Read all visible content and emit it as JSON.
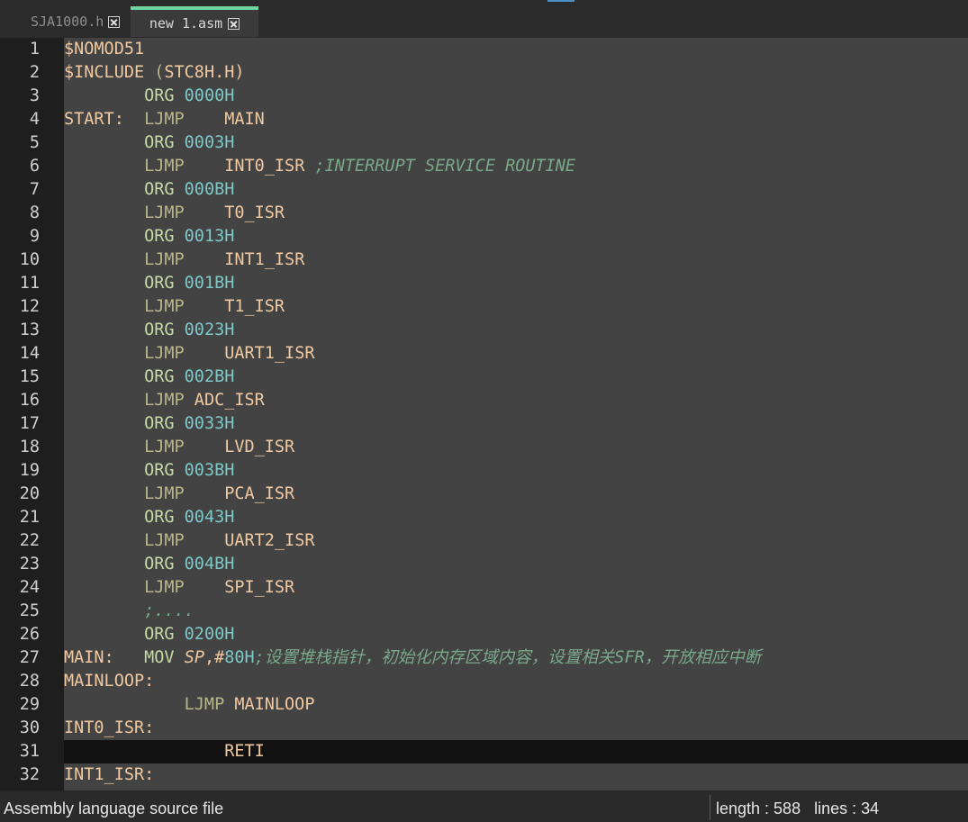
{
  "tabs": [
    {
      "label": "SJA1000.h",
      "active": false
    },
    {
      "label": "new 1.asm",
      "active": true
    }
  ],
  "editor": {
    "current_line": 31,
    "lines": [
      {
        "n": "1",
        "segs": [
          [
            "directive",
            "$NOMOD51"
          ]
        ]
      },
      {
        "n": "2",
        "segs": [
          [
            "directive",
            "$INCLUDE "
          ],
          [
            "paren",
            "("
          ],
          [
            "directive",
            "STC8H.H)"
          ]
        ]
      },
      {
        "n": "3",
        "segs": [
          [
            "op",
            "        "
          ],
          [
            "kw",
            "ORG"
          ],
          [
            "op",
            " "
          ],
          [
            "num",
            "0000H"
          ]
        ]
      },
      {
        "n": "4",
        "segs": [
          [
            "label",
            "START:"
          ],
          [
            "op",
            "  "
          ],
          [
            "jmp",
            "LJMP"
          ],
          [
            "op",
            "    MAIN"
          ]
        ]
      },
      {
        "n": "5",
        "segs": [
          [
            "op",
            "        "
          ],
          [
            "kw",
            "ORG"
          ],
          [
            "op",
            " "
          ],
          [
            "num",
            "0003H"
          ]
        ]
      },
      {
        "n": "6",
        "segs": [
          [
            "op",
            "        "
          ],
          [
            "jmp",
            "LJMP"
          ],
          [
            "op",
            "    INT0_ISR "
          ],
          [
            "comment",
            ";INTERRUPT SERVICE ROUTINE"
          ]
        ]
      },
      {
        "n": "7",
        "segs": [
          [
            "op",
            "        "
          ],
          [
            "kw",
            "ORG"
          ],
          [
            "op",
            " "
          ],
          [
            "num",
            "000BH"
          ]
        ]
      },
      {
        "n": "8",
        "segs": [
          [
            "op",
            "        "
          ],
          [
            "jmp",
            "LJMP"
          ],
          [
            "op",
            "    T0_ISR"
          ]
        ]
      },
      {
        "n": "9",
        "segs": [
          [
            "op",
            "        "
          ],
          [
            "kw",
            "ORG"
          ],
          [
            "op",
            " "
          ],
          [
            "num",
            "0013H"
          ]
        ]
      },
      {
        "n": "10",
        "segs": [
          [
            "op",
            "        "
          ],
          [
            "jmp",
            "LJMP"
          ],
          [
            "op",
            "    INT1_ISR"
          ]
        ]
      },
      {
        "n": "11",
        "segs": [
          [
            "op",
            "        "
          ],
          [
            "kw",
            "ORG"
          ],
          [
            "op",
            " "
          ],
          [
            "num",
            "001BH"
          ]
        ]
      },
      {
        "n": "12",
        "segs": [
          [
            "op",
            "        "
          ],
          [
            "jmp",
            "LJMP"
          ],
          [
            "op",
            "    T1_ISR"
          ]
        ]
      },
      {
        "n": "13",
        "segs": [
          [
            "op",
            "        "
          ],
          [
            "kw",
            "ORG"
          ],
          [
            "op",
            " "
          ],
          [
            "num",
            "0023H"
          ]
        ]
      },
      {
        "n": "14",
        "segs": [
          [
            "op",
            "        "
          ],
          [
            "jmp",
            "LJMP"
          ],
          [
            "op",
            "    UART1_ISR"
          ]
        ]
      },
      {
        "n": "15",
        "segs": [
          [
            "op",
            "        "
          ],
          [
            "kw",
            "ORG"
          ],
          [
            "op",
            " "
          ],
          [
            "num",
            "002BH"
          ]
        ]
      },
      {
        "n": "16",
        "segs": [
          [
            "op",
            "        "
          ],
          [
            "jmp",
            "LJMP"
          ],
          [
            "op",
            " ADC_ISR"
          ]
        ]
      },
      {
        "n": "17",
        "segs": [
          [
            "op",
            "        "
          ],
          [
            "kw",
            "ORG"
          ],
          [
            "op",
            " "
          ],
          [
            "num",
            "0033H"
          ]
        ]
      },
      {
        "n": "18",
        "segs": [
          [
            "op",
            "        "
          ],
          [
            "jmp",
            "LJMP"
          ],
          [
            "op",
            "    LVD_ISR"
          ]
        ]
      },
      {
        "n": "19",
        "segs": [
          [
            "op",
            "        "
          ],
          [
            "kw",
            "ORG"
          ],
          [
            "op",
            " "
          ],
          [
            "num",
            "003BH"
          ]
        ]
      },
      {
        "n": "20",
        "segs": [
          [
            "op",
            "        "
          ],
          [
            "jmp",
            "LJMP"
          ],
          [
            "op",
            "    PCA_ISR"
          ]
        ]
      },
      {
        "n": "21",
        "segs": [
          [
            "op",
            "        "
          ],
          [
            "kw",
            "ORG"
          ],
          [
            "op",
            " "
          ],
          [
            "num",
            "0043H"
          ]
        ]
      },
      {
        "n": "22",
        "segs": [
          [
            "op",
            "        "
          ],
          [
            "jmp",
            "LJMP"
          ],
          [
            "op",
            "    UART2_ISR"
          ]
        ]
      },
      {
        "n": "23",
        "segs": [
          [
            "op",
            "        "
          ],
          [
            "kw",
            "ORG"
          ],
          [
            "op",
            " "
          ],
          [
            "num",
            "004BH"
          ]
        ]
      },
      {
        "n": "24",
        "segs": [
          [
            "op",
            "        "
          ],
          [
            "jmp",
            "LJMP"
          ],
          [
            "op",
            "    SPI_ISR"
          ]
        ]
      },
      {
        "n": "25",
        "segs": [
          [
            "op",
            "        "
          ],
          [
            "comment",
            ";...."
          ]
        ]
      },
      {
        "n": "26",
        "segs": [
          [
            "op",
            "        "
          ],
          [
            "kw",
            "ORG"
          ],
          [
            "op",
            " "
          ],
          [
            "num",
            "0200H"
          ]
        ]
      },
      {
        "n": "27",
        "segs": [
          [
            "label",
            "MAIN:"
          ],
          [
            "op",
            "   "
          ],
          [
            "kw",
            "MOV"
          ],
          [
            "op",
            " "
          ],
          [
            "reg",
            "SP"
          ],
          [
            "op",
            ",#"
          ],
          [
            "num",
            "80H"
          ],
          [
            "comment",
            ";设置堆栈指针，初始化内存区域内容，设置相关SFR，开放相应中断"
          ]
        ]
      },
      {
        "n": "28",
        "segs": [
          [
            "label",
            "MAINLOOP:"
          ]
        ]
      },
      {
        "n": "29",
        "segs": [
          [
            "op",
            "            "
          ],
          [
            "jmp",
            "LJMP"
          ],
          [
            "op",
            " MAINLOOP"
          ]
        ]
      },
      {
        "n": "30",
        "segs": [
          [
            "label",
            "INT0_ISR:"
          ]
        ]
      },
      {
        "n": "31",
        "segs": [
          [
            "op",
            "                RETI"
          ]
        ]
      },
      {
        "n": "32",
        "segs": [
          [
            "label",
            "INT1_ISR:"
          ]
        ]
      }
    ]
  },
  "status": {
    "file_type": "Assembly language source file",
    "length_label": "length : ",
    "length_value": "588",
    "lines_label": "lines : ",
    "lines_value": "34"
  }
}
